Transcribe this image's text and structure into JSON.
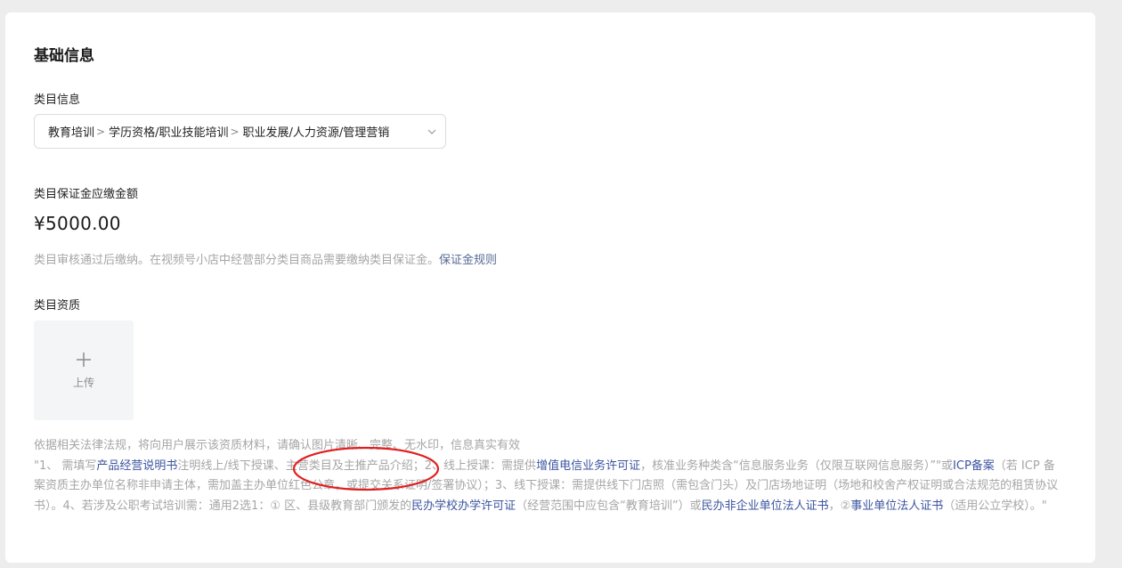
{
  "basic_info": {
    "title": "基础信息"
  },
  "category": {
    "label": "类目信息",
    "path": [
      "教育培训",
      "学历资格/职业技能培训",
      "职业发展/人力资源/管理营销"
    ],
    "separator": ">"
  },
  "deposit": {
    "label": "类目保证金应缴金额",
    "amount": "¥5000.00",
    "note": "类目审核通过后缴纳。在视频号小店中经营部分类目商品需要缴纳类目保证金。",
    "rule_link": "保证金规则"
  },
  "qualification": {
    "label": "类目资质",
    "upload_label": "上传",
    "intro": "依据相关法律法规，将向用户展示该资质材料，请确认图片清晰、完整、无水印，信息真实有效",
    "req": {
      "t1": "\"1、 需填写",
      "l1": "产品经营说明书",
      "t2": "注明线上/线下授课、主营类目及主推产品介绍；2、线上授课：需提供",
      "l2": "增值电信业务许可证",
      "t3": "，核准业务种类含“信息服务业务（仅限互联网信息服务）”\"或",
      "l3": "ICP备案",
      "t4": "（若 ICP 备案资质主办单位名称非申请主体，需加盖主办单位红色公章，或提交关系证明/签署协议）；3、线下授课：需提供线下门店照（需包含门头）及门店场地证明（场地和校舍产权证明或合法规范的租赁协议书）。4、若涉及公职考试培训需：通用2选1：① 区、县级教育部门颁发的",
      "l4": "民办学校办学许可证",
      "t5": "（经营范围中应包含“教育培训”）或",
      "l5": "民办非企业单位法人证书",
      "t6": "，②",
      "l6": "事业单位法人证书",
      "t7": "（适用公立学校）。\""
    }
  },
  "colors": {
    "background": "#ededed",
    "card": "#ffffff",
    "link": "#576b95",
    "doc_link": "#3c55a0",
    "muted_text": "#a6a6a6",
    "annotation": "#e02020"
  }
}
